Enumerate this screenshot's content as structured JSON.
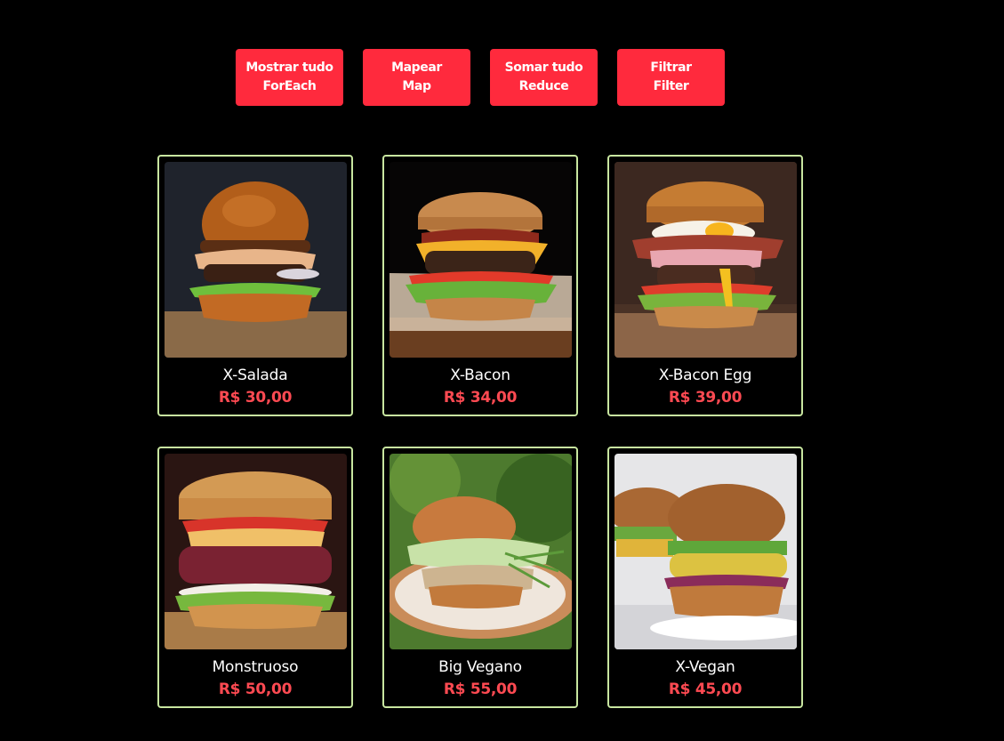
{
  "colors": {
    "background": "#000000",
    "button": "#ff2a3d",
    "card_border": "#c8e6a0",
    "price": "#ff4a52"
  },
  "buttons": [
    {
      "line1": "Mostrar tudo",
      "line2": "ForEach"
    },
    {
      "line1": "Mapear",
      "line2": "Map"
    },
    {
      "line1": "Somar tudo",
      "line2": "Reduce"
    },
    {
      "line1": "Filtrar",
      "line2": "Filter"
    }
  ],
  "menu": [
    {
      "name": "X-Salada",
      "price": "R$ 30,00",
      "image": "burger-photo"
    },
    {
      "name": "X-Bacon",
      "price": "R$ 34,00",
      "image": "burger-photo"
    },
    {
      "name": "X-Bacon Egg",
      "price": "R$ 39,00",
      "image": "burger-photo"
    },
    {
      "name": "Monstruoso",
      "price": "R$ 50,00",
      "image": "burger-photo"
    },
    {
      "name": "Big Vegano",
      "price": "R$ 55,00",
      "image": "burger-photo"
    },
    {
      "name": "X-Vegan",
      "price": "R$ 45,00",
      "image": "burger-photo"
    }
  ]
}
